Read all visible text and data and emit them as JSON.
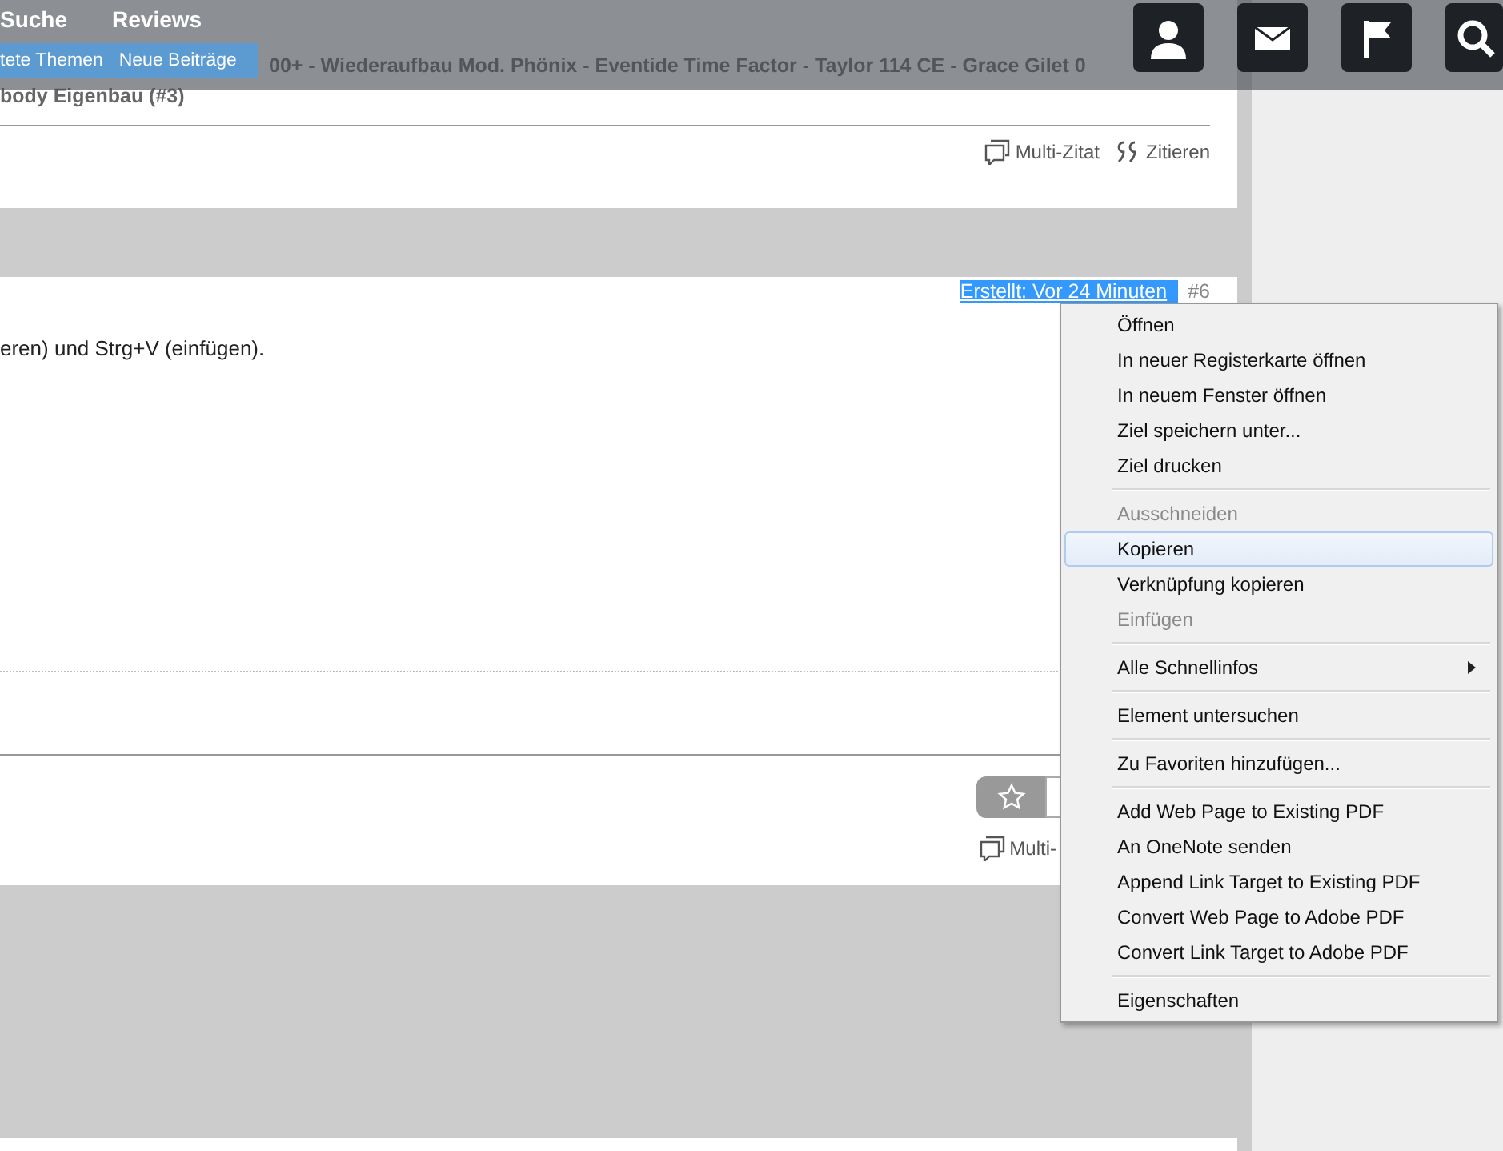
{
  "nav": {
    "items": [
      "Suche",
      "Reviews"
    ],
    "submenu": [
      "tete Themen",
      "Neue Beiträge"
    ]
  },
  "posts": [
    {
      "title_lines": [
        "00+ - Wiederaufbau Mod. Phönix - Eventide Time Factor - Taylor 114 CE - Grace Gilet 0",
        "body Eigenbau (#3)"
      ],
      "actions": [
        "Multi-Zitat",
        "Zitieren"
      ]
    },
    {
      "created": "Erstellt: Vor 24 Minuten",
      "created_selected": true,
      "number": "#6",
      "body": "eren) und Strg+V (einfügen).",
      "actions": [
        "Multi-"
      ]
    }
  ],
  "context_menu": [
    [
      {
        "label": "Öffnen",
        "disabled": false,
        "selected": false,
        "submenu": false
      },
      {
        "label": "In neuer Registerkarte öffnen",
        "disabled": false,
        "selected": false,
        "submenu": false
      },
      {
        "label": "In neuem Fenster öffnen",
        "disabled": false,
        "selected": false,
        "submenu": false
      },
      {
        "label": "Ziel speichern unter...",
        "disabled": false,
        "selected": false,
        "submenu": false
      },
      {
        "label": "Ziel drucken",
        "disabled": false,
        "selected": false,
        "submenu": false
      }
    ],
    [
      {
        "label": "Ausschneiden",
        "disabled": true,
        "selected": false,
        "submenu": false
      },
      {
        "label": "Kopieren",
        "disabled": false,
        "selected": true,
        "submenu": false
      },
      {
        "label": "Verknüpfung kopieren",
        "disabled": false,
        "selected": false,
        "submenu": false
      },
      {
        "label": "Einfügen",
        "disabled": true,
        "selected": false,
        "submenu": false
      }
    ],
    [
      {
        "label": "Alle Schnellinfos",
        "disabled": false,
        "selected": false,
        "submenu": true
      }
    ],
    [
      {
        "label": "Element untersuchen",
        "disabled": false,
        "selected": false,
        "submenu": false
      }
    ],
    [
      {
        "label": "Zu Favoriten hinzufügen...",
        "disabled": false,
        "selected": false,
        "submenu": false
      }
    ],
    [
      {
        "label": "Add Web Page to Existing PDF",
        "disabled": false,
        "selected": false,
        "submenu": false
      },
      {
        "label": "An OneNote senden",
        "disabled": false,
        "selected": false,
        "submenu": false
      },
      {
        "label": "Append Link Target to Existing PDF",
        "disabled": false,
        "selected": false,
        "submenu": false
      },
      {
        "label": "Convert Web Page to Adobe PDF",
        "disabled": false,
        "selected": false,
        "submenu": false
      },
      {
        "label": "Convert Link Target to Adobe PDF",
        "disabled": false,
        "selected": false,
        "submenu": false
      }
    ],
    [
      {
        "label": "Eigenschaften",
        "disabled": false,
        "selected": false,
        "submenu": false
      }
    ]
  ]
}
